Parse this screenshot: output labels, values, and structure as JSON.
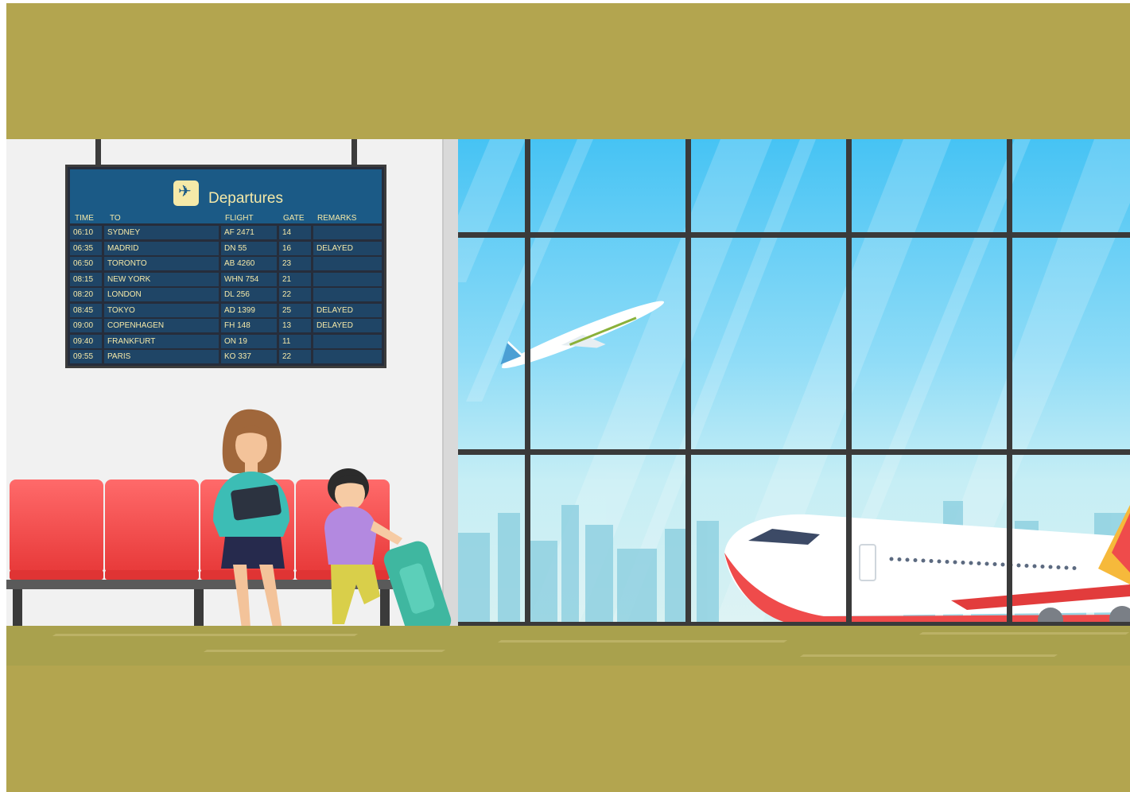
{
  "board": {
    "title": "Departures",
    "icon": "plane-departure-icon",
    "headers": {
      "time": "TIME",
      "to": "TO",
      "flight": "FLIGHT",
      "gate": "GATE",
      "remarks": "REMARKS"
    },
    "rows": [
      {
        "time": "06:10",
        "to": "SYDNEY",
        "flight": "AF 2471",
        "gate": "14",
        "remarks": ""
      },
      {
        "time": "06:35",
        "to": "MADRID",
        "flight": "DN 55",
        "gate": "16",
        "remarks": "DELAYED"
      },
      {
        "time": "06:50",
        "to": "TORONTO",
        "flight": "AB 4260",
        "gate": "23",
        "remarks": ""
      },
      {
        "time": "08:15",
        "to": "NEW YORK",
        "flight": "WHN 754",
        "gate": "21",
        "remarks": ""
      },
      {
        "time": "08:20",
        "to": "LONDON",
        "flight": "DL 256",
        "gate": "22",
        "remarks": ""
      },
      {
        "time": "08:45",
        "to": "TOKYO",
        "flight": "AD 1399",
        "gate": "25",
        "remarks": "DELAYED"
      },
      {
        "time": "09:00",
        "to": "COPENHAGEN",
        "flight": "FH 148",
        "gate": "13",
        "remarks": "DELAYED"
      },
      {
        "time": "09:40",
        "to": "FRANKFURT",
        "flight": "ON 19",
        "gate": "11",
        "remarks": ""
      },
      {
        "time": "09:55",
        "to": "PARIS",
        "flight": "KO 337",
        "gate": "22",
        "remarks": ""
      }
    ]
  },
  "colors": {
    "background": "#b3a54f",
    "board_header": "#1b5a86",
    "board_text": "#f5e9a8",
    "seat": "#f04848",
    "sky": "#46c3f4"
  }
}
